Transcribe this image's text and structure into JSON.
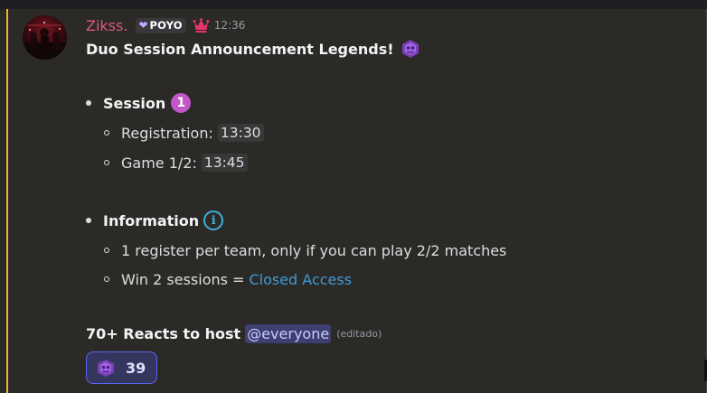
{
  "message": {
    "author": "Zikss.",
    "guild_tag": "POYO",
    "timestamp": "12:36",
    "title": "Duo Session Announcement Legends!",
    "session_heading": "Session",
    "session_number": "1",
    "registration_label": "Registration:",
    "registration_time": "13:30",
    "game_label": "Game 1/2:",
    "game_time": "13:45",
    "info_heading": "Information",
    "info_icon_glyph": "i",
    "info_line_1": "1 register per team, only if you can play 2/2 matches",
    "info_line_2_prefix": "Win 2 sessions =",
    "info_line_2_link": "Closed Access",
    "footer_text": "70+ Reacts to host",
    "mention": "@everyone",
    "edited": "(editado)"
  },
  "reactions": [
    {
      "emoji": "poyo-logo-icon",
      "count": "39"
    }
  ],
  "colors": {
    "username": "#e0567a",
    "link": "#3f9bd9",
    "accent_bar": "#f0b232",
    "mention_bg": "#3c3f70",
    "reaction_border": "#5865f2"
  }
}
